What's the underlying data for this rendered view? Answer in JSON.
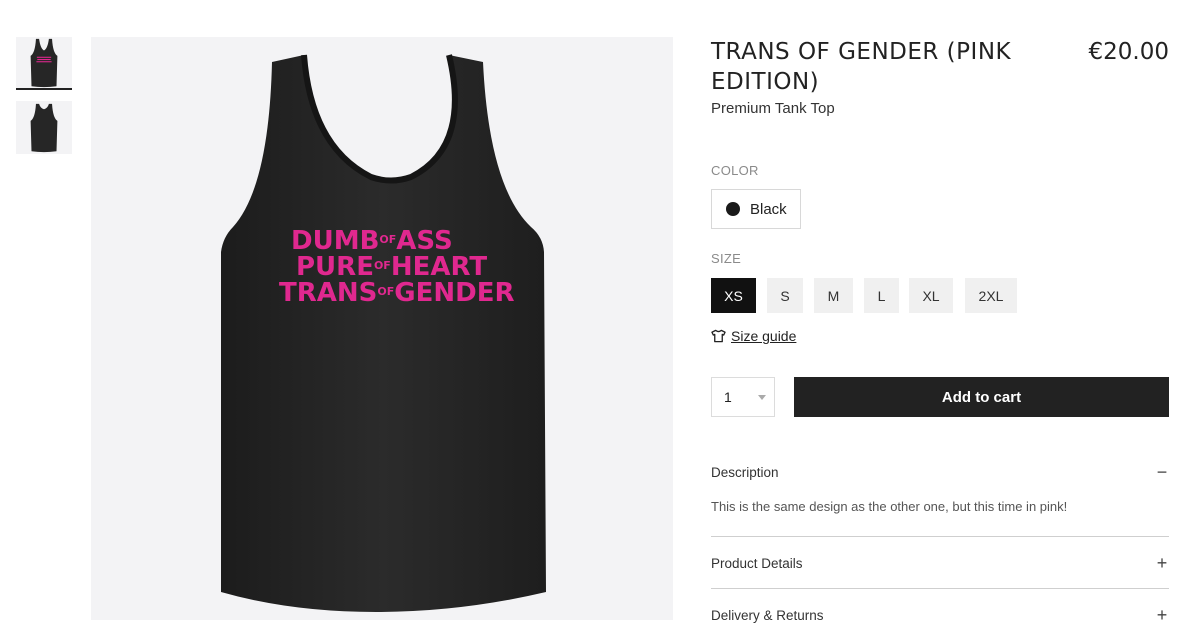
{
  "product": {
    "title": "TRANS OF GENDER (PINK EDITION)",
    "price": "€20.00",
    "subtitle": "Premium Tank Top",
    "print_lines": [
      {
        "big1": "DUMB",
        "small": "OF",
        "big2": "ASS"
      },
      {
        "big1": "PURE",
        "small": "OF",
        "big2": "HEART"
      },
      {
        "big1": "TRANS",
        "small": "OF",
        "big2": "GENDER"
      }
    ]
  },
  "options": {
    "color_label": "COLOR",
    "color_value": "Black",
    "size_label": "SIZE",
    "sizes": [
      "XS",
      "S",
      "M",
      "L",
      "XL",
      "2XL"
    ],
    "selected_size": "XS",
    "size_guide": "Size guide"
  },
  "cart": {
    "quantity": "1",
    "add_label": "Add to cart"
  },
  "accordion": [
    {
      "title": "Description",
      "icon": "−",
      "expanded": true,
      "body": "This is the same design as the other one, but this time in pink!"
    },
    {
      "title": "Product Details",
      "icon": "+",
      "expanded": false
    },
    {
      "title": "Delivery & Returns",
      "icon": "+",
      "expanded": false
    }
  ],
  "colors": {
    "shirt": "#242424",
    "print": "#e0288f",
    "image_bg": "#f3f3f5",
    "button_dark": "#222222"
  }
}
